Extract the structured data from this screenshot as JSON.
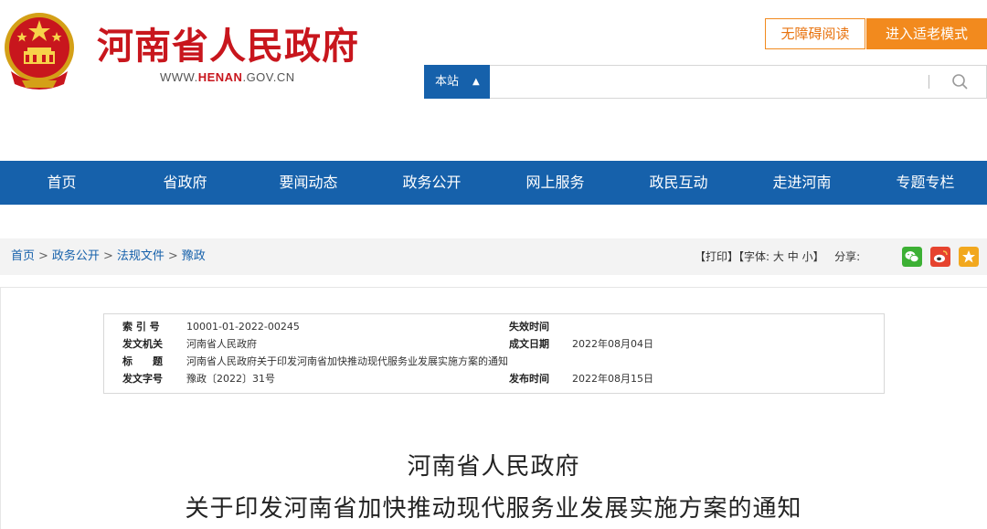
{
  "header": {
    "site_name": "河南省人民政府",
    "url_prefix": "WWW.",
    "url_highlight": "HENAN",
    "url_suffix": ".GOV.CN",
    "accessible_label": "无障碍阅读",
    "elder_mode_label": "进入适老模式",
    "search_scope_label": "本站",
    "search_placeholder": ""
  },
  "nav": {
    "items": [
      "首页",
      "省政府",
      "要闻动态",
      "政务公开",
      "网上服务",
      "政民互动",
      "走进河南",
      "专题专栏"
    ]
  },
  "breadcrumb": {
    "items": [
      "首页",
      "政务公开",
      "法规文件",
      "豫政"
    ],
    "separator": ">"
  },
  "tools": {
    "print": "【打印】",
    "font_open": "【字体:",
    "font_large": "大",
    "font_medium": "中",
    "font_small": "小",
    "font_close": "】",
    "share_label": "分享:"
  },
  "info": {
    "index_label": "索 引 号",
    "index_value": "10001-01-2022-00245",
    "expire_label": "失效时间",
    "expire_value": "",
    "issuer_label": "发文机关",
    "issuer_value": "河南省人民政府",
    "created_label": "成文日期",
    "created_value": "2022年08月04日",
    "title_label": "标　　题",
    "title_value": "河南省人民政府关于印发河南省加快推动现代服务业发展实施方案的通知",
    "docno_label": "发文字号",
    "docno_value": "豫政〔2022〕31号",
    "publish_label": "发布时间",
    "publish_value": "2022年08月15日"
  },
  "document": {
    "title_line1": "河南省人民政府",
    "title_line2": "关于印发河南省加快推动现代服务业发展实施方案的通知"
  },
  "colors": {
    "brand_red": "#c8161d",
    "nav_blue": "#1661ab",
    "orange": "#f28a1e",
    "wechat_green": "#3cb034",
    "weibo_red": "#e6432e",
    "favorite_yellow": "#f2a81e"
  },
  "icons": {
    "emblem": "national-emblem-icon",
    "search": "search-icon",
    "updown": "updown-arrows-icon",
    "wechat": "wechat-icon",
    "weibo": "weibo-icon",
    "favorite": "star-icon"
  }
}
